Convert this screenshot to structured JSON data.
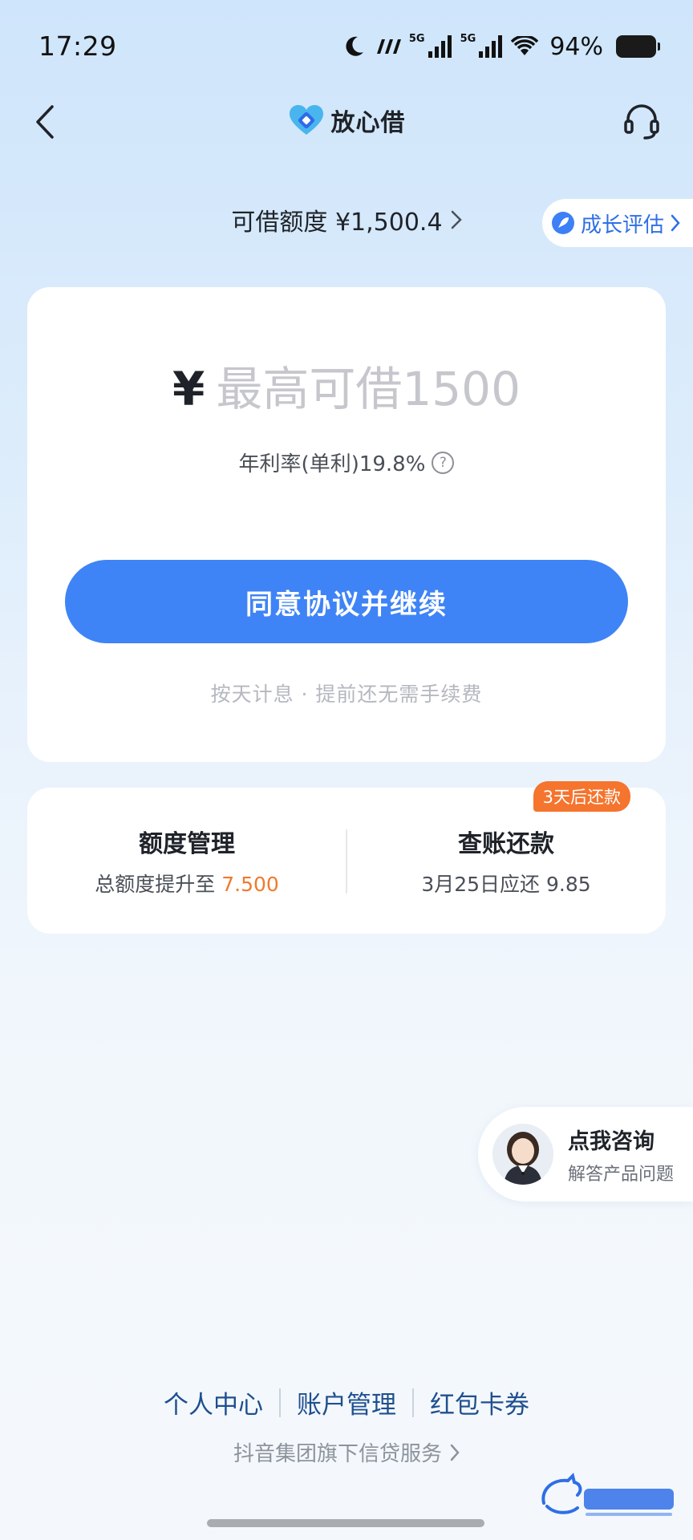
{
  "status_bar": {
    "time": "17:29",
    "network_label_1": "5G",
    "network_label_2": "5G",
    "battery": "94%",
    "icons": [
      "moon-icon",
      "carrier-icon",
      "signal-icon",
      "signal-icon",
      "wifi-icon",
      "battery-icon"
    ]
  },
  "header": {
    "brand_name": "放心借",
    "back_icon": "back-arrow-icon",
    "service_icon": "headset-icon"
  },
  "credit": {
    "label": "可借额度 ¥1,500.4"
  },
  "growth": {
    "label": "成长评估"
  },
  "loan": {
    "currency_symbol": "¥",
    "amount_placeholder": "最高可借1500",
    "rate_text": "年利率(单利)19.8%",
    "help_symbol": "?",
    "agree_button": "同意协议并继续",
    "tip": "按天计息 · 提前还无需手续费"
  },
  "manage": {
    "left_title": "额度管理",
    "left_sub_prefix": "总额度提升至",
    "left_sub_value": "7.500",
    "right_title": "查账还款",
    "right_sub": "3月25日应还 9.85",
    "badge": "3天后还款"
  },
  "consult": {
    "title": "点我咨询",
    "subtitle": "解答产品问题"
  },
  "footer": {
    "links": [
      "个人中心",
      "账户管理",
      "红包卡券"
    ],
    "service_text": "抖音集团旗下信贷服务"
  },
  "colors": {
    "primary": "#3f84f6",
    "accent_orange": "#f5742e",
    "link_blue": "#1f4f8f"
  }
}
